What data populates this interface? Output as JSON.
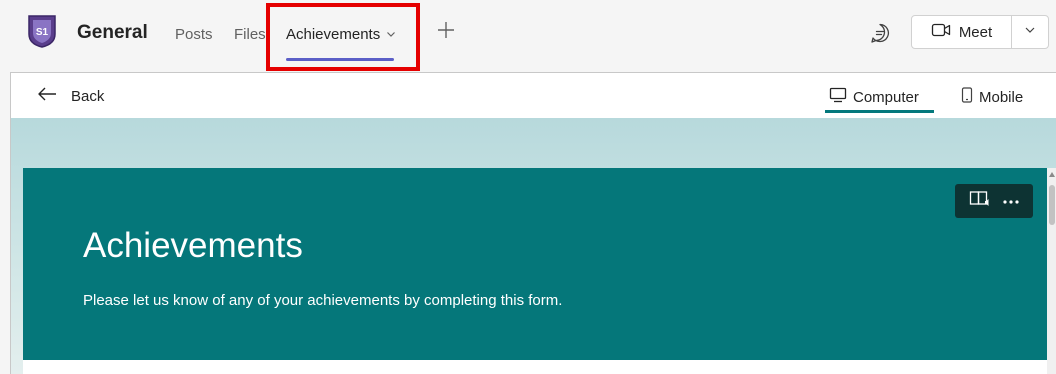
{
  "team": {
    "avatar_text": "S1",
    "channel_name": "General"
  },
  "tabs": [
    {
      "label": "Posts"
    },
    {
      "label": "Files"
    },
    {
      "label": "Achievements",
      "active": true
    }
  ],
  "toolbar": {
    "meet_label": "Meet",
    "icons": [
      "chat-icon",
      "video-camera-icon",
      "chevron-down-icon",
      "plus-icon"
    ]
  },
  "subbar": {
    "back_label": "Back",
    "view_computer": "Computer",
    "view_mobile": "Mobile",
    "active_view": "Computer"
  },
  "form": {
    "title": "Achievements",
    "description": "Please let us know of any of your achievements by completing this form."
  },
  "colors": {
    "accent": "#5b5fc7",
    "highlight": "#e50000",
    "form_header": "#05777a",
    "view_underline": "#03787c"
  }
}
